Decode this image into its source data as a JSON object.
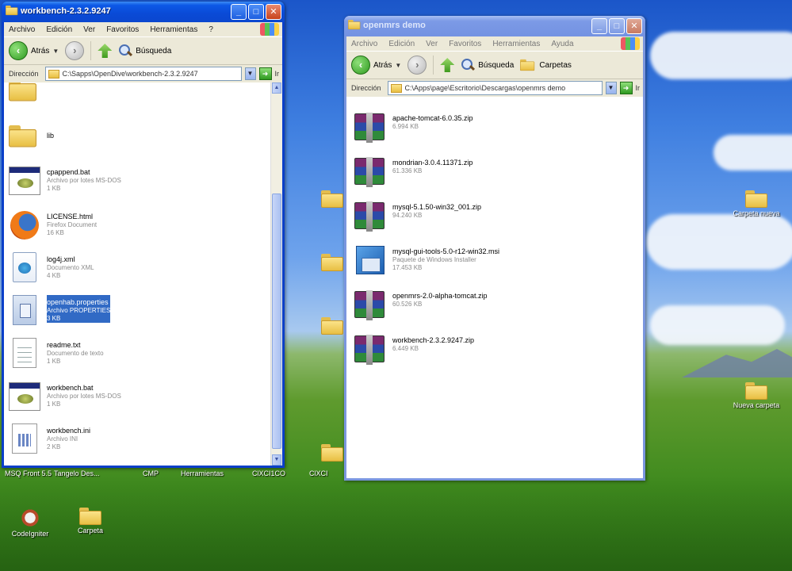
{
  "desktop": {
    "icons": [
      {
        "label": ""
      },
      {
        "label": ""
      },
      {
        "label": ""
      },
      {
        "label": ""
      },
      {
        "label": "Carpeta nueva"
      },
      {
        "label": "Nueva carpeta"
      },
      {
        "label": "CodeIgniter"
      },
      {
        "label": "Carpeta"
      }
    ],
    "strip": [
      "MSQ Front 5.5",
      "Tangelo Des...",
      "CMP",
      "Herramientas",
      "ClXCI1CO",
      "ClXCI"
    ]
  },
  "left_window": {
    "title": "workbench-2.3.2.9247",
    "menu": [
      "Archivo",
      "Edición",
      "Ver",
      "Favoritos",
      "Herramientas",
      "?"
    ],
    "toolbar": {
      "back_label": "Atrás",
      "search_label": "Búsqueda"
    },
    "address": {
      "label": "Dirección",
      "path": "C:\\Sapps\\OpenDive\\workbench-2.3.2.9247",
      "go_label": "Ir"
    },
    "files": [
      {
        "name": "",
        "meta1": "",
        "meta2": "",
        "icon": "folder-icon"
      },
      {
        "name": "lib",
        "meta1": "",
        "meta2": "",
        "icon": "folder-icon"
      },
      {
        "name": "cpappend.bat",
        "meta1": "Archivo por lotes MS-DOS",
        "meta2": "1 KB",
        "icon": "batch-file-icon"
      },
      {
        "name": "LICENSE.html",
        "meta1": "Firefox Document",
        "meta2": "16 KB",
        "icon": "firefox-document-icon"
      },
      {
        "name": "log4j.xml",
        "meta1": "Documento XML",
        "meta2": "4 KB",
        "icon": "xml-document-icon"
      },
      {
        "name": "openhab.properties",
        "meta1": "Archivo PROPERTIES",
        "meta2": "3 KB",
        "icon": "properties-file-icon"
      },
      {
        "name": "readme.txt",
        "meta1": "Documento de texto",
        "meta2": "1 KB",
        "icon": "text-file-icon"
      },
      {
        "name": "workbench.bat",
        "meta1": "Archivo por lotes MS-DOS",
        "meta2": "1 KB",
        "icon": "batch-file-icon"
      },
      {
        "name": "workbench.ini",
        "meta1": "Archivo INI",
        "meta2": "2 KB",
        "icon": "config-file-icon"
      }
    ]
  },
  "right_window": {
    "title": "openmrs demo",
    "menu": [
      "Archivo",
      "Edición",
      "Ver",
      "Favoritos",
      "Herramientas",
      "Ayuda"
    ],
    "toolbar": {
      "back_label": "Atrás",
      "search_label": "Búsqueda",
      "folders_label": "Carpetas"
    },
    "address": {
      "label": "Dirección",
      "path": "C:\\Apps\\page\\Escritorio\\Descargas\\openmrs demo",
      "go_label": "Ir"
    },
    "files": [
      {
        "name": "apache-tomcat-6.0.35.zip",
        "meta": "6.994 KB",
        "icon": "winrar-archive-icon"
      },
      {
        "name": "mondrian-3.0.4.11371.zip",
        "meta": "61.336 KB",
        "icon": "winrar-archive-icon"
      },
      {
        "name": "mysql-5.1.50-win32_001.zip",
        "meta": "94.240 KB",
        "icon": "winrar-archive-icon"
      },
      {
        "name": "mysql-gui-tools-5.0-r12-win32.msi",
        "meta": "Paquete de Windows Installer",
        "meta2": "17.453 KB",
        "icon": "installer-package-icon"
      },
      {
        "name": "openmrs-2.0-alpha-tomcat.zip",
        "meta": "60.526 KB",
        "icon": "winrar-archive-icon"
      },
      {
        "name": "workbench-2.3.2.9247.zip",
        "meta": "6.449 KB",
        "icon": "winrar-archive-icon"
      }
    ]
  }
}
